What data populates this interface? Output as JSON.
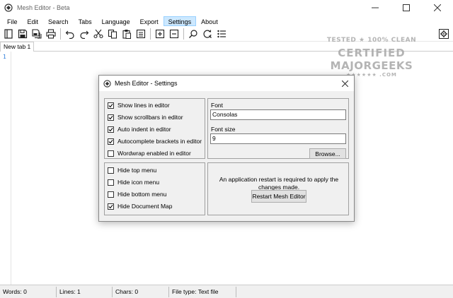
{
  "window": {
    "title": "Mesh Editor - Beta",
    "controls": [
      "minimize",
      "maximize",
      "close"
    ]
  },
  "menu": [
    {
      "label": "File"
    },
    {
      "label": "Edit"
    },
    {
      "label": "Search"
    },
    {
      "label": "Tabs"
    },
    {
      "label": "Language"
    },
    {
      "label": "Export"
    },
    {
      "label": "Settings",
      "active": true
    },
    {
      "label": "About"
    }
  ],
  "toolbar": {
    "icons": [
      "document-map-icon",
      "save-icon",
      "save-all-icon",
      "print-icon",
      "undo-icon",
      "redo-icon",
      "cut-icon",
      "copy-icon",
      "paste-icon",
      "select-all-icon",
      "zoom-in-icon",
      "zoom-out-icon",
      "search-icon",
      "replace-icon",
      "list-icon"
    ],
    "right_icon": "settings-icon"
  },
  "tabs": [
    {
      "label": "New tab 1"
    }
  ],
  "editor": {
    "line_number": "1"
  },
  "status": {
    "words": "Words: 0",
    "lines": "Lines: 1",
    "chars": "Chars: 0",
    "filetype": "File type: Text file"
  },
  "dialog": {
    "title": "Mesh Editor - Settings",
    "editor_options": [
      {
        "label": "Show lines in editor",
        "checked": true
      },
      {
        "label": "Show scrollbars in editor",
        "checked": true
      },
      {
        "label": "Auto indent in editor",
        "checked": true
      },
      {
        "label": "Autocomplete brackets in editor",
        "checked": true
      },
      {
        "label": "Wordwrap enabled in editor",
        "checked": false
      }
    ],
    "hide_options": [
      {
        "label": "Hide top menu",
        "checked": false
      },
      {
        "label": "Hide icon menu",
        "checked": false
      },
      {
        "label": "Hide bottom menu",
        "checked": false
      },
      {
        "label": "Hide Document Map",
        "checked": true
      }
    ],
    "font_label": "Font",
    "font_value": "Consolas",
    "font_size_label": "Font size",
    "font_size_value": "9",
    "browse_label": "Browse...",
    "restart_message": "An application restart is required to apply the changes made.",
    "restart_label": "Restart Mesh Editor"
  },
  "watermark": {
    "line1": "TESTED ★ 100% CLEAN",
    "line2": "CERTIFIED",
    "line3": "MAJORGEEKS",
    "line4": "★★★★★★ .COM"
  },
  "colors": {
    "menu_active_bg": "#cce8ff",
    "line_number": "#2b7bd9",
    "dialog_bg": "#f0f0f0"
  }
}
